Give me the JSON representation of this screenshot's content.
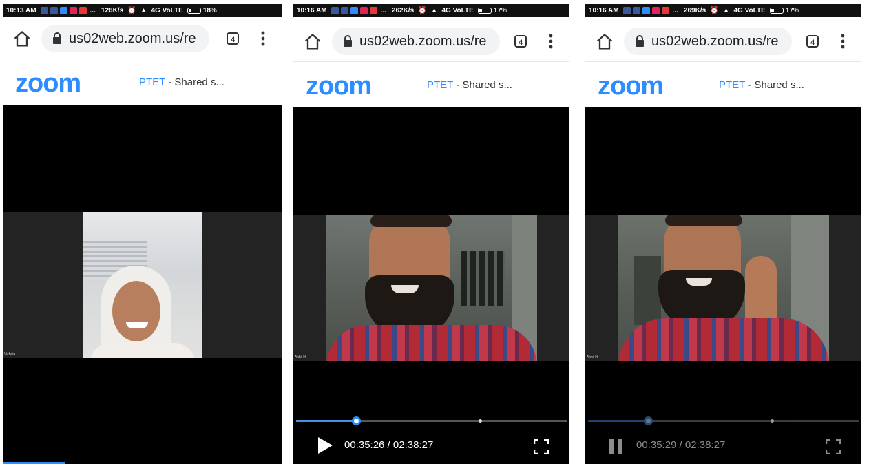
{
  "phones": [
    {
      "status": {
        "time": "10:13 AM",
        "dots": "...",
        "speed": "126K/s",
        "network": "4G VoLTE",
        "battery": "18%"
      },
      "browser": {
        "url": "us02web.zoom.us/re",
        "tab_count": "4"
      },
      "zoom": {
        "logo": "zoom",
        "title_prefix": "PTET",
        "title_rest": " - Shared s..."
      },
      "participant_name": "Vichoia",
      "player": null
    },
    {
      "status": {
        "time": "10:16 AM",
        "dots": "...",
        "speed": "262K/s",
        "network": "4G VoLTE",
        "battery": "17%"
      },
      "browser": {
        "url": "us02web.zoom.us/re",
        "tab_count": "4"
      },
      "zoom": {
        "logo": "zoom",
        "title_prefix": "PTET",
        "title_rest": " - Shared s..."
      },
      "participant_name": "Akhil H",
      "player": {
        "timecode": "00:35:26 / 02:38:27",
        "state": "paused",
        "button": "play-icon",
        "progress": 0.222,
        "buffered": 0.68
      }
    },
    {
      "status": {
        "time": "10:16 AM",
        "dots": "...",
        "speed": "269K/s",
        "network": "4G VoLTE",
        "battery": "17%"
      },
      "browser": {
        "url": "us02web.zoom.us/re",
        "tab_count": "4"
      },
      "zoom": {
        "logo": "zoom",
        "title_prefix": "PTET",
        "title_rest": " - Shared s..."
      },
      "participant_name": "Akhil H",
      "player": {
        "timecode": "00:35:29 / 02:38:27",
        "state": "playing",
        "button": "pause-icon",
        "progress": 0.222,
        "buffered": 0.68
      }
    }
  ],
  "colors": {
    "zoom_blue": "#2d8cff",
    "progress_blue": "#4a90e2",
    "video_bg": "#000000",
    "status_bg": "#111111"
  },
  "notification_icons": [
    "facebook-icon",
    "facebook-icon",
    "messenger-icon",
    "gmail-icon",
    "mail-icon"
  ]
}
